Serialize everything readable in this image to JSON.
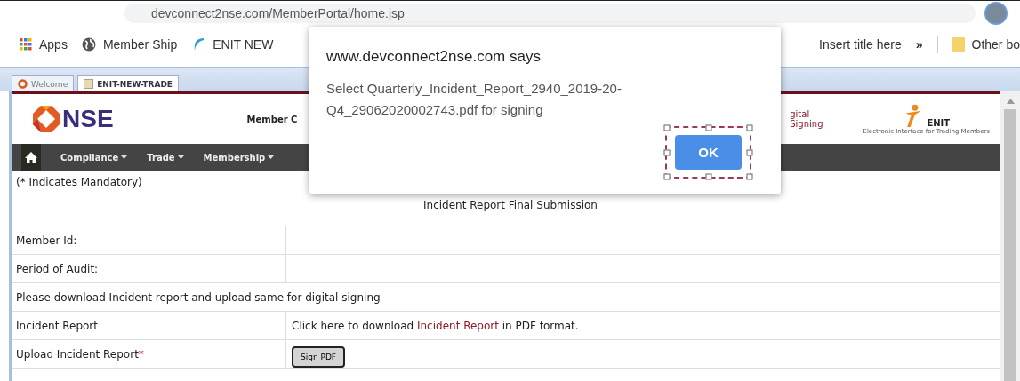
{
  "browser": {
    "address": "devconnect2nse.com/MemberPortal/home.jsp",
    "bookmarks": [
      {
        "label": "Apps",
        "kind": "apps"
      },
      {
        "label": "Member Ship",
        "kind": "globe"
      },
      {
        "label": "ENIT NEW",
        "kind": "swoosh"
      },
      {
        "label": "Insert title here",
        "kind": "plain"
      }
    ],
    "overflow": "»",
    "other_bookmarks": "Other bo"
  },
  "tabs": [
    {
      "label": "Welcome",
      "selected": false
    },
    {
      "label": "ENIT-NEW-TRADE",
      "selected": true
    }
  ],
  "header": {
    "logo": "NSE",
    "center_text": "Member C",
    "right_text": [
      "gital",
      "Signing"
    ],
    "partner_logo": "ENIT",
    "partner_tagline": "Electronic Interface for Trading Members"
  },
  "nav": [
    "Compliance",
    "Trade",
    "Membership"
  ],
  "mandatory_note": "(* Indicates Mandatory)",
  "form_title": "Incident Report Final Submission",
  "rows": [
    {
      "kind": "pair",
      "label": "Member Id:"
    },
    {
      "kind": "pair",
      "label": "Period of Audit:"
    },
    {
      "kind": "note",
      "label": "Please download Incident report and upload same for digital signing"
    },
    {
      "kind": "link",
      "label": "Incident Report",
      "before": "Click here to download ",
      "link": "Incident Report",
      "after": " in PDF format."
    },
    {
      "kind": "button",
      "label": "Upload Incident Report",
      "required": true,
      "required_mark": "*",
      "button": "Sign PDF"
    }
  ],
  "dialog": {
    "title": "www.devconnect2nse.com says",
    "message": "Select Quarterly_Incident_Report_2940_2019-20-Q4_29062020002743.pdf for signing",
    "ok": "OK"
  }
}
